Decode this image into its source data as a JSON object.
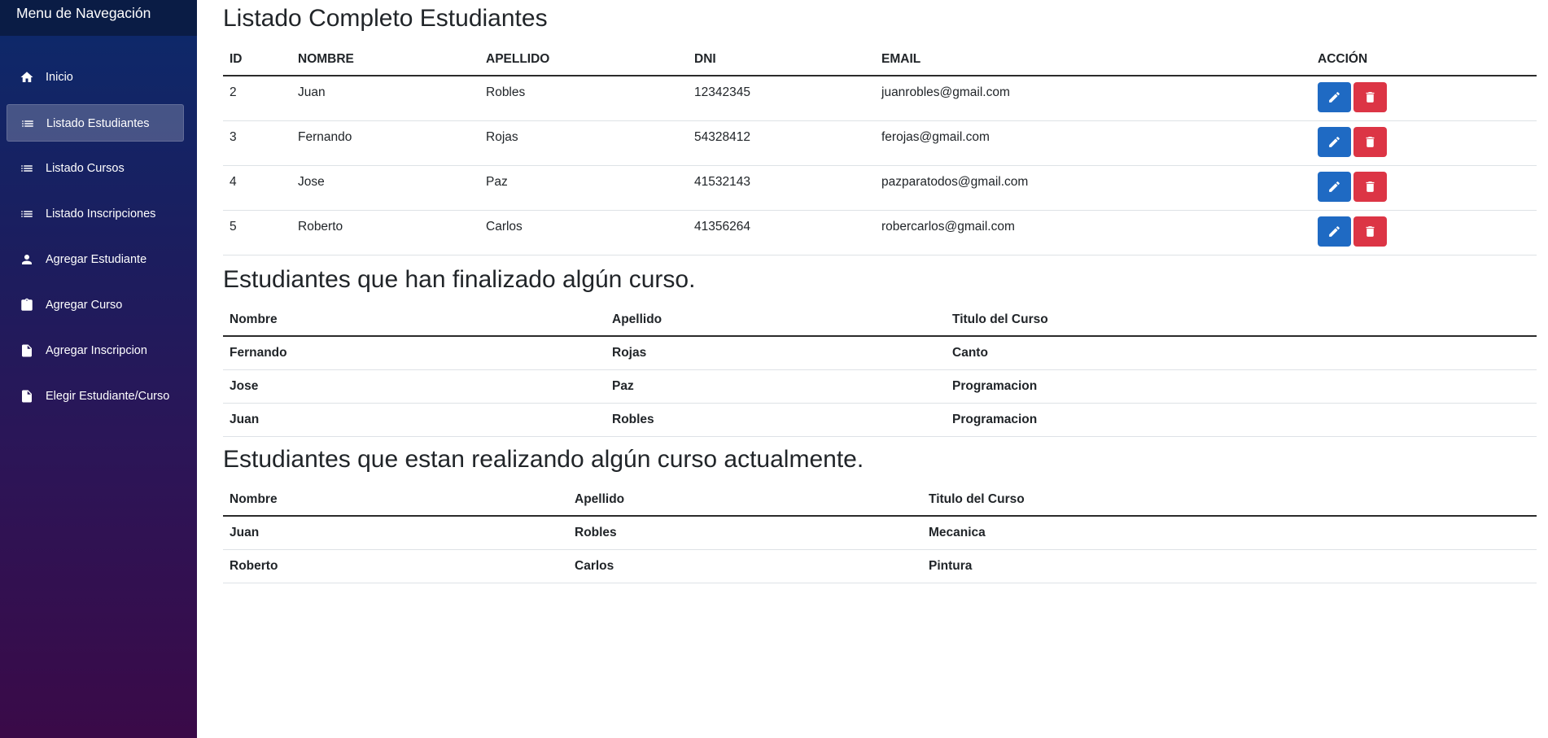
{
  "sidebar": {
    "title": "Menu de Navegación",
    "items": [
      {
        "label": "Inicio",
        "icon": "home-icon",
        "active": false
      },
      {
        "label": "Listado Estudiantes",
        "icon": "list-icon",
        "active": true
      },
      {
        "label": "Listado Cursos",
        "icon": "list-icon",
        "active": false
      },
      {
        "label": "Listado Inscripciones",
        "icon": "list-icon",
        "active": false
      },
      {
        "label": "Agregar Estudiante",
        "icon": "person-icon",
        "active": false
      },
      {
        "label": "Agregar Curso",
        "icon": "clipboard-icon",
        "active": false
      },
      {
        "label": "Agregar Inscripcion",
        "icon": "file-icon",
        "active": false
      },
      {
        "label": "Elegir Estudiante/Curso",
        "icon": "file-icon",
        "active": false
      }
    ]
  },
  "students": {
    "title": "Listado Completo Estudiantes",
    "headers": [
      "ID",
      "NOMBRE",
      "APELLIDO",
      "DNI",
      "EMAIL",
      "ACCIÓN"
    ],
    "rows": [
      {
        "id": "2",
        "nombre": "Juan",
        "apellido": "Robles",
        "dni": "12342345",
        "email": "juanrobles@gmail.com"
      },
      {
        "id": "3",
        "nombre": "Fernando",
        "apellido": "Rojas",
        "dni": "54328412",
        "email": "ferojas@gmail.com"
      },
      {
        "id": "4",
        "nombre": "Jose",
        "apellido": "Paz",
        "dni": "41532143",
        "email": "pazparatodos@gmail.com"
      },
      {
        "id": "5",
        "nombre": "Roberto",
        "apellido": "Carlos",
        "dni": "41356264",
        "email": "robercarlos@gmail.com"
      }
    ],
    "edit_color": "#1f6ac3",
    "delete_color": "#dc3545"
  },
  "finished": {
    "title": "Estudiantes que han finalizado algún curso.",
    "headers": [
      "Nombre",
      "Apellido",
      "Titulo del Curso"
    ],
    "rows": [
      {
        "nombre": "Fernando",
        "apellido": "Rojas",
        "curso": "Canto"
      },
      {
        "nombre": "Jose",
        "apellido": "Paz",
        "curso": "Programacion"
      },
      {
        "nombre": "Juan",
        "apellido": "Robles",
        "curso": "Programacion"
      }
    ]
  },
  "current": {
    "title": "Estudiantes que estan realizando algún curso actualmente.",
    "headers": [
      "Nombre",
      "Apellido",
      "Titulo del Curso"
    ],
    "rows": [
      {
        "nombre": "Juan",
        "apellido": "Robles",
        "curso": "Mecanica"
      },
      {
        "nombre": "Roberto",
        "apellido": "Carlos",
        "curso": "Pintura"
      }
    ]
  }
}
